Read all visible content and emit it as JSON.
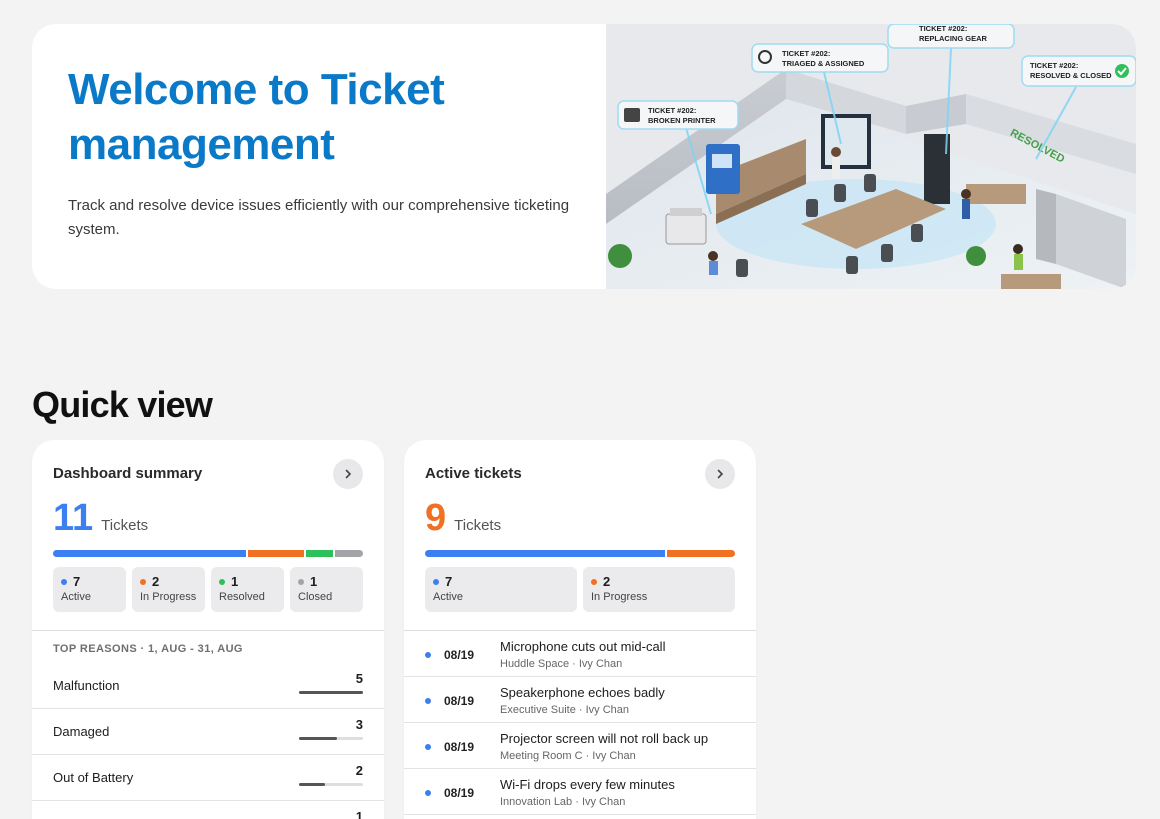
{
  "hero": {
    "title": "Welcome to Ticket management",
    "subtitle": "Track and resolve device issues efficiently with our comprehensive ticketing system.",
    "illustration": {
      "callouts": [
        {
          "line1": "TICKET #202:",
          "line2": "BROKEN PRINTER"
        },
        {
          "line1": "TICKET #202:",
          "line2": "TRIAGED & ASSIGNED"
        },
        {
          "line1": "TICKET #202:",
          "line2": "REPLACING GEAR"
        },
        {
          "line1": "TICKET #202:",
          "line2": "RESOLVED & CLOSED"
        }
      ],
      "floor_label": "RESOLVED"
    }
  },
  "section_title": "Quick view",
  "summary": {
    "title": "Dashboard summary",
    "count": "11",
    "count_label": "Tickets",
    "segments": [
      {
        "value": 7,
        "color": "#3b7ff0"
      },
      {
        "value": 2,
        "color": "#f07122"
      },
      {
        "value": 1,
        "color": "#2fbf5b"
      },
      {
        "value": 1,
        "color": "#a3a3a8"
      }
    ],
    "stats": [
      {
        "value": "7",
        "label": "Active",
        "color": "#3b7ff0"
      },
      {
        "value": "2",
        "label": "In Progress",
        "color": "#f07122"
      },
      {
        "value": "1",
        "label": "Resolved",
        "color": "#2fbf5b"
      },
      {
        "value": "1",
        "label": "Closed",
        "color": "#a3a3a8"
      }
    ],
    "reasons_heading": "TOP REASONS · 1, AUG - 31, AUG",
    "reasons": [
      {
        "label": "Malfunction",
        "count": "5",
        "fraction": 1.0
      },
      {
        "label": "Damaged",
        "count": "3",
        "fraction": 0.6
      },
      {
        "label": "Out of Battery",
        "count": "2",
        "fraction": 0.4
      },
      {
        "label": "",
        "count": "1",
        "fraction": 0.2
      }
    ]
  },
  "active": {
    "title": "Active tickets",
    "count": "9",
    "count_label": "Tickets",
    "segments": [
      {
        "value": 7,
        "color": "#3b7ff0"
      },
      {
        "value": 2,
        "color": "#f07122"
      }
    ],
    "stats": [
      {
        "value": "7",
        "label": "Active",
        "color": "#3b7ff0"
      },
      {
        "value": "2",
        "label": "In Progress",
        "color": "#f07122"
      }
    ],
    "tickets": [
      {
        "date": "08/19",
        "title": "Microphone cuts out mid-call",
        "meta": "Huddle Space · Ivy Chan"
      },
      {
        "date": "08/19",
        "title": "Speakerphone echoes badly",
        "meta": "Executive Suite · Ivy Chan"
      },
      {
        "date": "08/19",
        "title": "Projector screen will not roll back up",
        "meta": "Meeting Room C · Ivy Chan"
      },
      {
        "date": "08/19",
        "title": "Wi-Fi drops every few minutes",
        "meta": "Innovation Lab · Ivy Chan"
      }
    ]
  },
  "colors": {
    "accent": "#0a79c8",
    "active": "#3b7ff0",
    "in_progress": "#f07122",
    "resolved": "#2fbf5b",
    "closed": "#a3a3a8"
  }
}
